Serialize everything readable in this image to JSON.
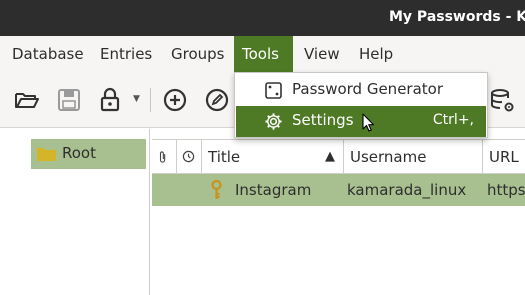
{
  "window": {
    "title": "My Passwords - Kee"
  },
  "menubar": {
    "items": [
      {
        "label": "Database"
      },
      {
        "label": "Entries"
      },
      {
        "label": "Groups"
      },
      {
        "label": "Tools"
      },
      {
        "label": "View"
      },
      {
        "label": "Help"
      }
    ],
    "active": "Tools"
  },
  "toolbar": {
    "buttons": [
      "open-database-icon",
      "save-database-icon",
      "lock-database-icon",
      "add-entry-icon",
      "edit-entry-icon",
      "database-settings-icon"
    ]
  },
  "tools_menu": {
    "items": [
      {
        "label": "Password Generator",
        "icon": "dice-icon",
        "shortcut": ""
      },
      {
        "label": "Settings",
        "icon": "gear-icon",
        "shortcut": "Ctrl+,"
      }
    ],
    "highlighted": "Settings"
  },
  "sidebar": {
    "groups": [
      {
        "label": "Root",
        "icon": "folder-icon",
        "selected": true
      }
    ]
  },
  "entries_table": {
    "columns": [
      "Title",
      "Username",
      "URL"
    ],
    "sort_indicator": "▲",
    "rows": [
      {
        "title": "Instagram",
        "username": "kamarada_linux",
        "url": "https:",
        "icon": "key-icon"
      }
    ]
  },
  "colors": {
    "accent": "#4e7a25",
    "selection": "#a8bf8f",
    "titlebar": "#2d2d2d",
    "folder": "#d4b52a"
  }
}
